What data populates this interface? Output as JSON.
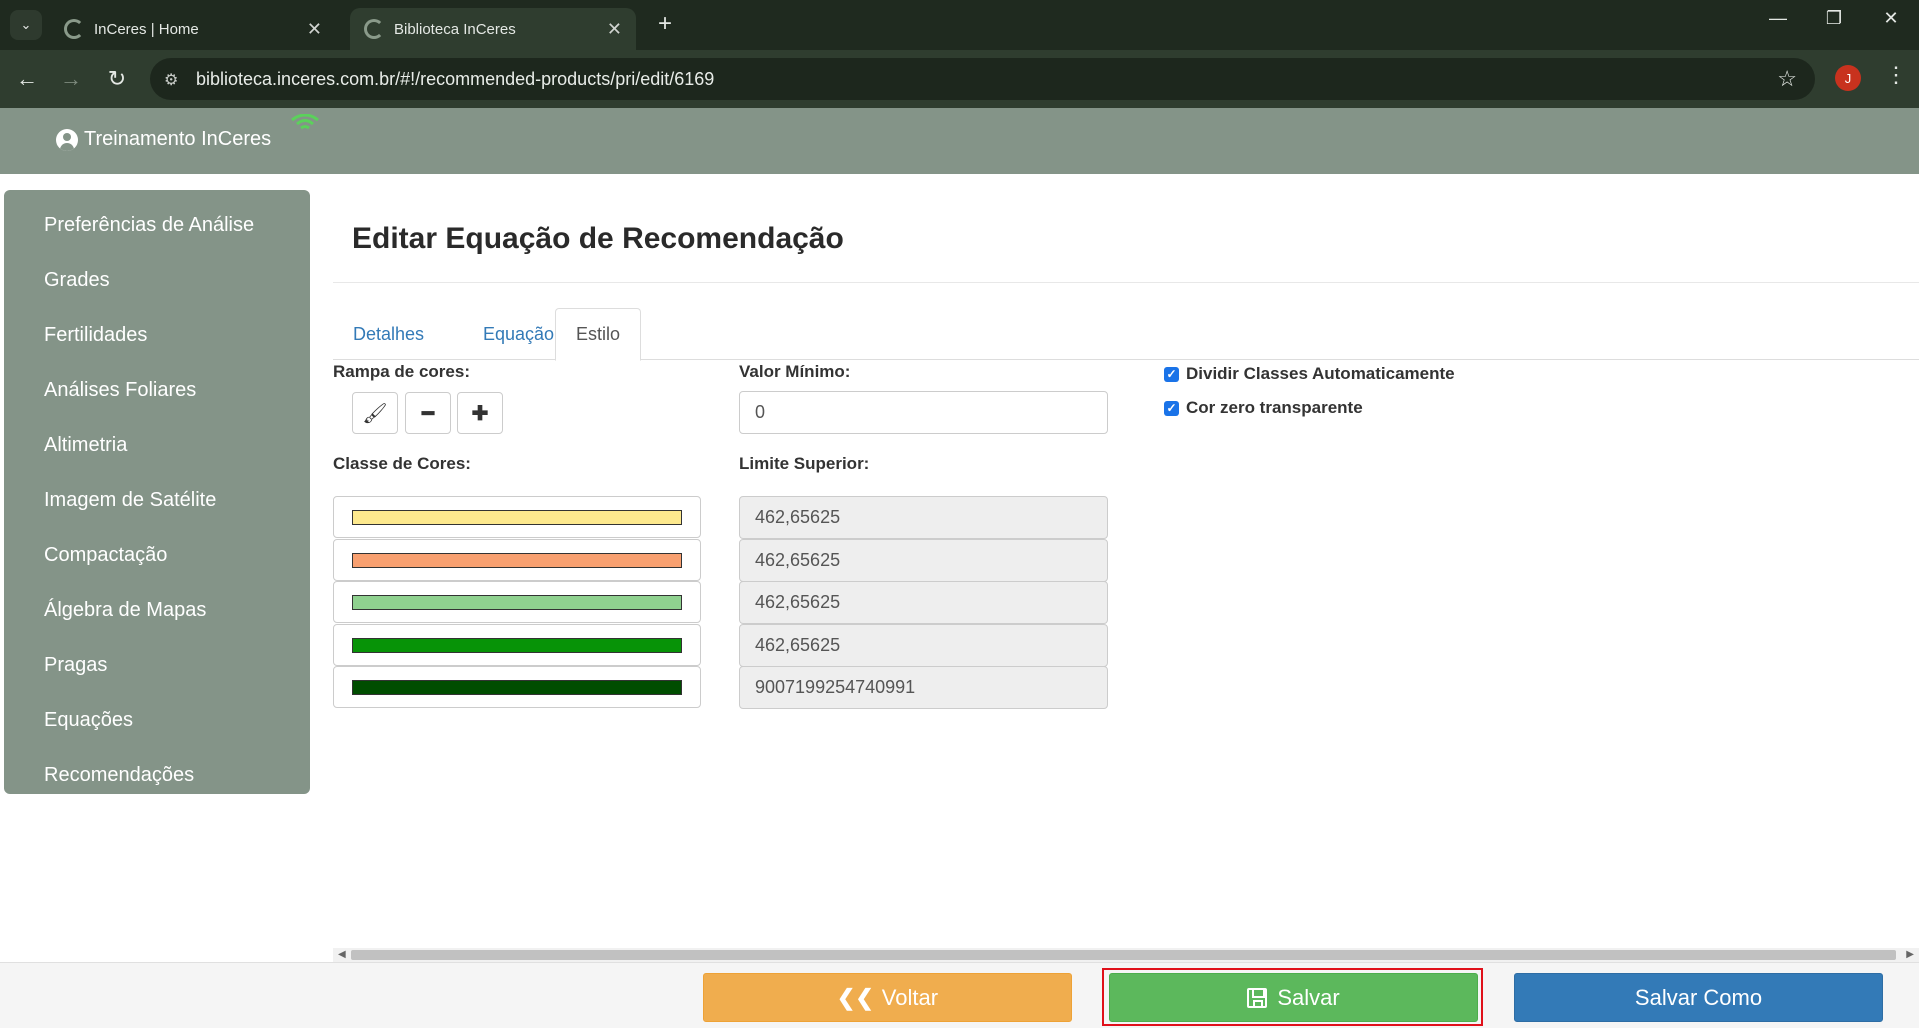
{
  "browser": {
    "tabs": [
      {
        "title": "InCeres | Home",
        "active": false
      },
      {
        "title": "Biblioteca InCeres",
        "active": true
      }
    ],
    "url": "biblioteca.inceres.com.br/#!/recommended-products/pri/edit/6169",
    "profile_initial": "J"
  },
  "header": {
    "user_name": "Treinamento InCeres"
  },
  "sidebar": {
    "items": [
      {
        "label": "Preferências de Análise"
      },
      {
        "label": "Grades"
      },
      {
        "label": "Fertilidades"
      },
      {
        "label": "Análises Foliares"
      },
      {
        "label": "Altimetria"
      },
      {
        "label": "Imagem de Satélite"
      },
      {
        "label": "Compactação"
      },
      {
        "label": "Álgebra de Mapas"
      },
      {
        "label": "Pragas"
      },
      {
        "label": "Equações"
      },
      {
        "label": "Recomendações"
      }
    ]
  },
  "main": {
    "title": "Editar Equação de Recomendação",
    "tabs": [
      {
        "label": "Detalhes",
        "active": false
      },
      {
        "label": "Equação",
        "active": false
      },
      {
        "label": "Estilo",
        "active": true
      }
    ],
    "color_ramp_label": "Rampa de cores:",
    "color_class_label": "Classe de Cores:",
    "min_value_label": "Valor Mínimo:",
    "min_value": "0",
    "upper_limit_label": "Limite Superior:",
    "color_classes": [
      {
        "color": "#fde98e",
        "upper_limit": "462,65625"
      },
      {
        "color": "#f8a070",
        "upper_limit": "462,65625"
      },
      {
        "color": "#8fd18f",
        "upper_limit": "462,65625"
      },
      {
        "color": "#079307",
        "upper_limit": "462,65625"
      },
      {
        "color": "#004d00",
        "upper_limit": "9007199254740991"
      }
    ],
    "checkboxes": [
      {
        "label": "Dividir Classes Automaticamente",
        "checked": true
      },
      {
        "label": "Cor zero transparente",
        "checked": true
      }
    ]
  },
  "footer": {
    "back_label": "Voltar",
    "save_label": "Salvar",
    "save_as_label": "Salvar Como"
  },
  "colors": {
    "sidebar_bg": "#849488",
    "back": "#f0ad4e",
    "save": "#5cb85c",
    "save_as": "#337ab7",
    "highlight": "#e0101a"
  }
}
